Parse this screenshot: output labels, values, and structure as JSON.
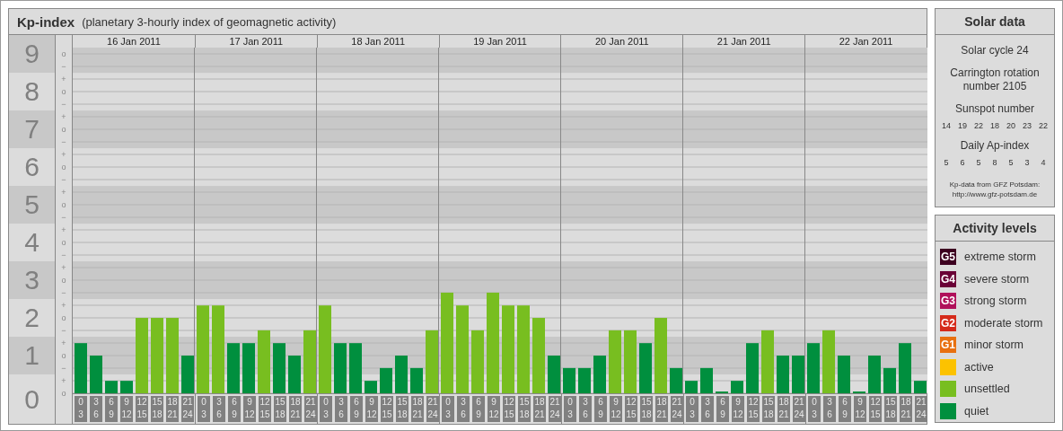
{
  "kp_panel": {
    "title": "Kp-index",
    "subtitle": "(planetary 3-hourly index of geomagnetic activity)",
    "dates": [
      "16 Jan 2011",
      "17 Jan 2011",
      "18 Jan 2011",
      "19 Jan 2011",
      "20 Jan 2011",
      "21 Jan 2011",
      "22 Jan 2011"
    ],
    "minor_ticks": [
      [
        "o",
        "−"
      ],
      [
        "+",
        "o",
        "−"
      ],
      [
        "+",
        "o",
        "−"
      ],
      [
        "+",
        "o",
        "−"
      ],
      [
        "+",
        "o",
        "−"
      ],
      [
        "+",
        "o",
        "−"
      ],
      [
        "+",
        "o",
        "−"
      ],
      [
        "+",
        "o",
        "−"
      ],
      [
        "+",
        "o",
        "−"
      ],
      [
        "+",
        "o"
      ]
    ],
    "chart_data": {
      "type": "bar",
      "ylim": [
        0,
        9.17
      ],
      "yticks": [
        0,
        1,
        2,
        3,
        4,
        5,
        6,
        7,
        8,
        9
      ],
      "grid": true,
      "bands": [
        {
          "axis": "y",
          "from": 0.5,
          "to": 1.5,
          "color": "#c8c8c8"
        },
        {
          "axis": "y",
          "from": 2.5,
          "to": 3.5,
          "color": "#c8c8c8"
        },
        {
          "axis": "y",
          "from": 4.5,
          "to": 5.5,
          "color": "#c8c8c8"
        },
        {
          "axis": "y",
          "from": 6.5,
          "to": 7.5,
          "color": "#c8c8c8"
        },
        {
          "axis": "y",
          "from": 8.5,
          "to": 9.17,
          "color": "#c8c8c8"
        }
      ],
      "categories": [
        "0\n3",
        "3\n6",
        "6\n9",
        "9\n12",
        "12\n15",
        "15\n18",
        "18\n21",
        "21\n24",
        "0\n3",
        "3\n6",
        "6\n9",
        "9\n12",
        "12\n15",
        "15\n18",
        "18\n21",
        "21\n24",
        "0\n3",
        "3\n6",
        "6\n9",
        "9\n12",
        "12\n15",
        "15\n18",
        "18\n21",
        "21\n24",
        "0\n3",
        "3\n6",
        "6\n9",
        "9\n12",
        "12\n15",
        "15\n18",
        "18\n21",
        "21\n24",
        "0\n3",
        "3\n6",
        "6\n9",
        "9\n12",
        "12\n15",
        "15\n18",
        "18\n21",
        "21\n24",
        "0\n3",
        "3\n6",
        "6\n9",
        "9\n12",
        "12\n15",
        "15\n18",
        "18\n21",
        "21\n24",
        "0\n3",
        "3\n6",
        "6\n9",
        "9\n12",
        "12\n15",
        "15\n18",
        "18\n21",
        "21\n24"
      ],
      "series": [
        {
          "color": "#008f3e",
          "values": [
            1.33,
            1,
            0.33,
            0.33,
            null,
            null,
            null,
            1,
            null,
            null,
            1.33,
            1.33,
            null,
            1.33,
            1,
            null,
            null,
            1.33,
            1.33,
            0.33,
            0.67,
            1,
            0.67,
            null,
            null,
            null,
            null,
            null,
            null,
            null,
            null,
            1,
            0.67,
            0.67,
            1,
            null,
            null,
            1.33,
            null,
            0.67,
            0.33,
            0.67,
            0,
            0.33,
            1.33,
            null,
            1,
            1,
            1.33,
            null,
            1,
            0,
            1,
            0.67,
            1.33,
            0.33
          ]
        },
        {
          "color": "#78be20",
          "values": [
            null,
            null,
            null,
            null,
            2,
            2,
            2,
            null,
            2.33,
            2.33,
            null,
            null,
            1.67,
            null,
            null,
            1.67,
            2.33,
            null,
            null,
            null,
            null,
            null,
            null,
            1.67,
            2.67,
            2.33,
            1.67,
            2.67,
            2.33,
            2.33,
            2,
            null,
            null,
            null,
            null,
            1.67,
            1.67,
            null,
            2,
            null,
            null,
            null,
            null,
            null,
            null,
            1.67,
            null,
            null,
            null,
            1.67,
            null,
            null,
            null,
            null,
            null,
            null
          ]
        }
      ]
    }
  },
  "solar_data": {
    "title": "Solar data",
    "solar_cycle": "Solar cycle 24",
    "carrington": "Carrington rotation number 2105",
    "sunspot": {
      "label": "Sunspot number",
      "values": [
        "14",
        "19",
        "22",
        "18",
        "20",
        "23",
        "22"
      ]
    },
    "ap_index": {
      "label": "Daily Ap-index",
      "values": [
        "5",
        "6",
        "5",
        "8",
        "5",
        "3",
        "4"
      ]
    },
    "source": [
      "Kp-data from GFZ Potsdam:",
      "http://www.gfz-potsdam.de"
    ]
  },
  "activity_levels": {
    "title": "Activity levels",
    "items": [
      {
        "badge": "G5",
        "label": "extreme storm",
        "color": "#3d0020"
      },
      {
        "badge": "G4",
        "label": "severe storm",
        "color": "#6a0036"
      },
      {
        "badge": "G3",
        "label": "strong storm",
        "color": "#b0105a"
      },
      {
        "badge": "G2",
        "label": "moderate storm",
        "color": "#d52a1a"
      },
      {
        "badge": "G1",
        "label": "minor storm",
        "color": "#e87010"
      },
      {
        "label": "active",
        "color": "#fcc200"
      },
      {
        "label": "unsettled",
        "color": "#78be20"
      },
      {
        "label": "quiet",
        "color": "#008f3e"
      }
    ]
  }
}
